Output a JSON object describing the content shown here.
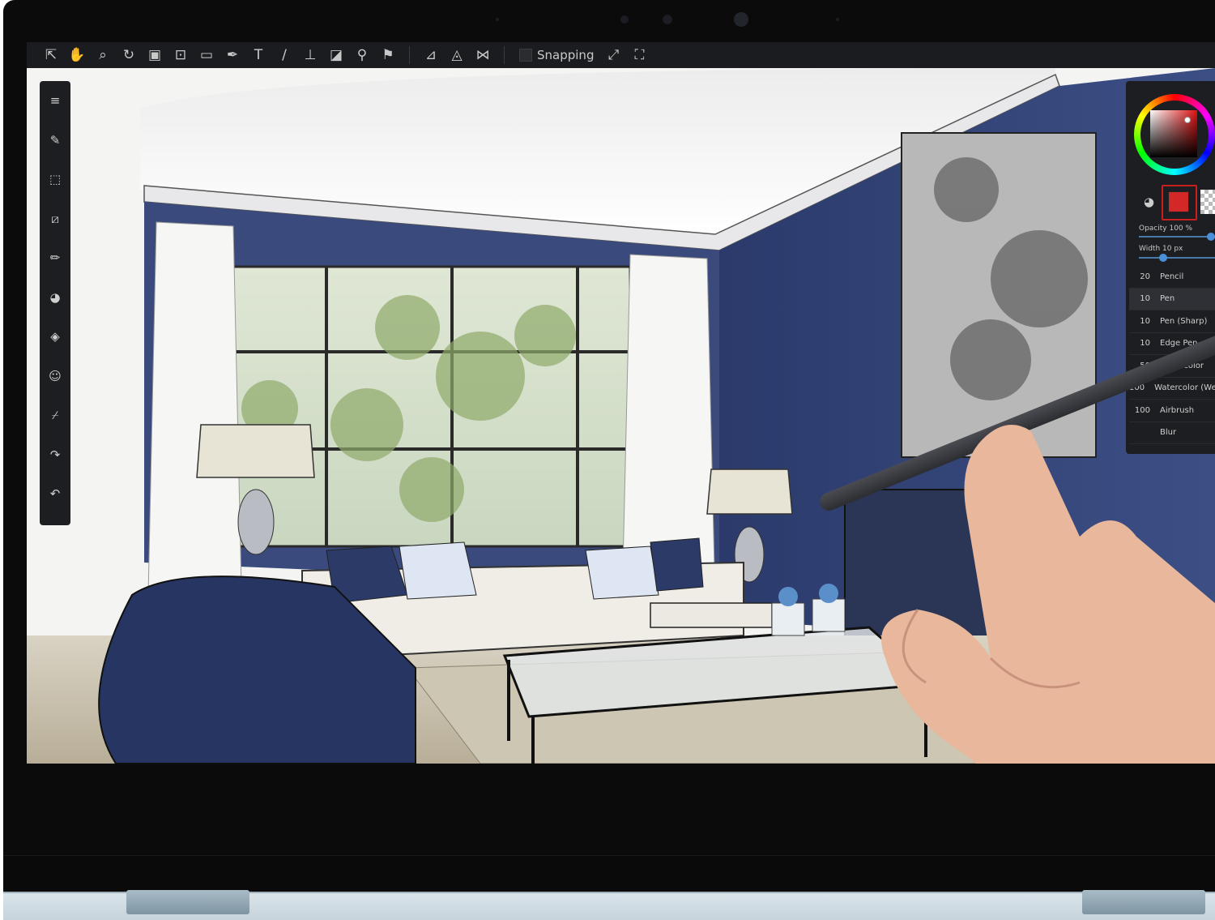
{
  "toolbar": {
    "tools": [
      {
        "name": "select-tool-icon",
        "glyph": "⇱"
      },
      {
        "name": "hand-tool-icon",
        "glyph": "✋"
      },
      {
        "name": "zoom-tool-icon",
        "glyph": "⌕"
      },
      {
        "name": "rotate-tool-icon",
        "glyph": "↻"
      },
      {
        "name": "record-tool-icon",
        "glyph": "▣"
      },
      {
        "name": "transform-tool-icon",
        "glyph": "⊡"
      },
      {
        "name": "rectangle-tool-icon",
        "glyph": "▭"
      },
      {
        "name": "pen-tool-icon",
        "glyph": "✒"
      },
      {
        "name": "text-tool-icon",
        "glyph": "T"
      },
      {
        "name": "brush-tool-icon",
        "glyph": "∕"
      },
      {
        "name": "stamp-tool-icon",
        "glyph": "⊥"
      },
      {
        "name": "eraser-tool-icon",
        "glyph": "◪"
      },
      {
        "name": "fill-tool-icon",
        "glyph": "⚲"
      },
      {
        "name": "pin-tool-icon",
        "glyph": "⚑"
      },
      {
        "name": "perspective-tool-icon",
        "glyph": "⊿"
      },
      {
        "name": "guide-tool-icon",
        "glyph": "◬"
      },
      {
        "name": "ruler-tool-icon",
        "glyph": "⋈"
      }
    ],
    "snapping_label": "Snapping",
    "snap_icons": [
      {
        "name": "snap-mode-icon",
        "glyph": "⤢"
      },
      {
        "name": "snap-settings-icon",
        "glyph": "⛶"
      }
    ]
  },
  "left_panel": {
    "tools": [
      {
        "name": "menu-icon",
        "glyph": "≡"
      },
      {
        "name": "edit-icon",
        "glyph": "✎"
      },
      {
        "name": "selection-icon",
        "glyph": "⬚"
      },
      {
        "name": "transform-icon",
        "glyph": "⧄"
      },
      {
        "name": "brush-icon",
        "glyph": "✏"
      },
      {
        "name": "color-palette-icon",
        "glyph": "◕"
      },
      {
        "name": "layers-icon",
        "glyph": "◈"
      },
      {
        "name": "emoji-icon",
        "glyph": "☺"
      },
      {
        "name": "eyedropper-icon",
        "glyph": "⌿"
      },
      {
        "name": "redo-icon",
        "glyph": "↷"
      },
      {
        "name": "undo-icon",
        "glyph": "↶"
      }
    ]
  },
  "right_panel": {
    "primary_color": "#d42828",
    "opacity_label": "Opacity 100 %",
    "opacity_value": 1.0,
    "width_label": "Width 10 px",
    "width_value": 0.3,
    "brushes": [
      {
        "size": "20",
        "name": "Pencil",
        "selected": false
      },
      {
        "size": "10",
        "name": "Pen",
        "selected": true
      },
      {
        "size": "10",
        "name": "Pen (Sharp)",
        "selected": false
      },
      {
        "size": "10",
        "name": "Edge Pen",
        "selected": false
      },
      {
        "size": "50",
        "name": "Watercolor",
        "selected": false
      },
      {
        "size": "100",
        "name": "Watercolor (We",
        "selected": false
      },
      {
        "size": "100",
        "name": "Airbrush",
        "selected": false
      },
      {
        "size": "",
        "name": "Blur",
        "selected": false
      }
    ]
  }
}
